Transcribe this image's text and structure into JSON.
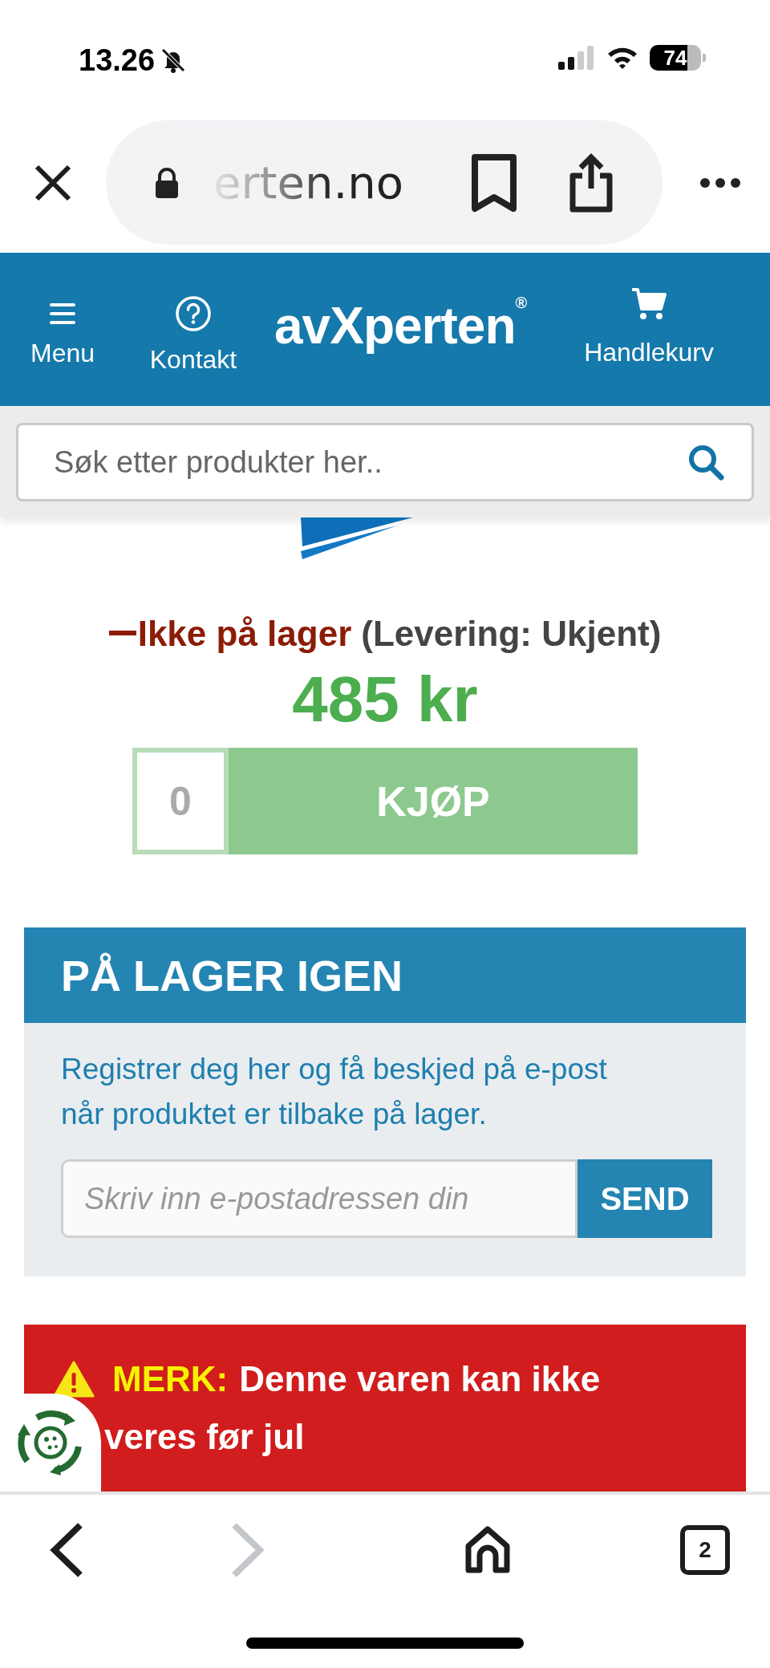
{
  "status_bar": {
    "time": "13.26",
    "battery": "74"
  },
  "browser": {
    "url": "erten.no"
  },
  "header": {
    "logo": "avXperten$^{®}$",
    "nav": [
      {
        "kind": "menu",
        "label": "Menu"
      },
      {
        "kind": "contact",
        "label": "Kontakt"
      },
      {
        "kind": "cart",
        "label": "Handlekurv"
      }
    ]
  },
  "search": {
    "placeholder": "Søk etter produkter her.."
  },
  "product": {
    "stock_status": "Ikke på lager",
    "delivery": "(Levering: Ukjent)",
    "price": "485 kr",
    "quantity": "0",
    "buy_button": {
      "label": "KJØP",
      "disabled": true
    }
  },
  "restock": {
    "title": "PÅ LAGER IGEN",
    "text": "Registrer deg her og få beskjed på e-post når produktet er tilbake på lager.",
    "email_placeholder": "Skriv inn e-postadressen din",
    "send_button": "SEND"
  },
  "notice": {
    "label": "MERK:",
    "line_1": "Denne varen kan ikke",
    "line_2": "veres før jul"
  },
  "toolbar": {
    "back": {
      "disabled": false
    },
    "forward": {
      "disabled": true
    },
    "tabs_count": "2"
  }
}
